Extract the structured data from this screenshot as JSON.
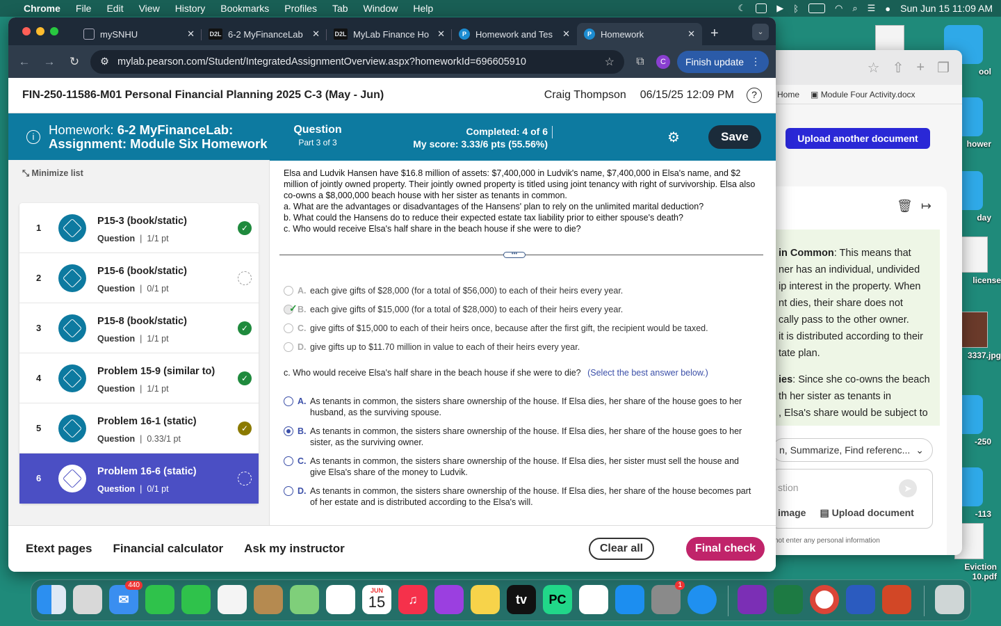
{
  "menubar": {
    "app": "Chrome",
    "items": [
      "File",
      "Edit",
      "View",
      "History",
      "Bookmarks",
      "Profiles",
      "Tab",
      "Window",
      "Help"
    ],
    "datetime": "Sun Jun 15  11:09 AM"
  },
  "desktop": {
    "icons": [
      "ool",
      "hower",
      "day",
      "license",
      "3337.jpg",
      "-250",
      "-113",
      "Eviction\n10.pdf"
    ]
  },
  "browser": {
    "tabs": [
      {
        "label": "mySNHU",
        "favicon": "shield-icon"
      },
      {
        "label": "6-2 MyFinanceLab",
        "favicon": "D2L"
      },
      {
        "label": "MyLab Finance Ho",
        "favicon": "D2L"
      },
      {
        "label": "Homework and Tes",
        "favicon": "P"
      },
      {
        "label": "Homework",
        "favicon": "P"
      }
    ],
    "url": "mylab.pearson.com/Student/IntegratedAssignmentOverview.aspx?homeworkId=696605910",
    "profile_initial": "C",
    "finish_update": "Finish update"
  },
  "course": {
    "title": "FIN-250-11586-M01 Personal Financial Planning 2025 C-3 (May - Jun)",
    "user": "Craig Thompson",
    "datetime": "06/15/25 12:09 PM",
    "help": "?"
  },
  "homework": {
    "line1_prefix": "Homework: ",
    "line1_bold": "6-2 MyFinanceLab:",
    "line2": "Assignment: Module Six Homework",
    "question_label": "Question",
    "part": "Part 3 of 3",
    "completed_label": "Completed: 4 of 6",
    "score_label": "My score: 3.33/6 pts (55.56%)",
    "save": "Save"
  },
  "sidebar": {
    "minimize": "Minimize list",
    "questions": [
      {
        "num": "1",
        "name": "P15-3 (book/static)",
        "type": "Question",
        "pts": "1/1 pt",
        "status": "done"
      },
      {
        "num": "2",
        "name": "P15-6 (book/static)",
        "type": "Question",
        "pts": "0/1 pt",
        "status": "empty"
      },
      {
        "num": "3",
        "name": "P15-8 (book/static)",
        "type": "Question",
        "pts": "1/1 pt",
        "status": "done"
      },
      {
        "num": "4",
        "name": "Problem 15-9 (similar to)",
        "type": "Question",
        "pts": "1/1 pt",
        "status": "done"
      },
      {
        "num": "5",
        "name": "Problem 16-1 (static)",
        "type": "Question",
        "pts": "0.33/1 pt",
        "status": "partial"
      },
      {
        "num": "6",
        "name": "Problem 16-6 (static)",
        "type": "Question",
        "pts": "0/1 pt",
        "status": "empty"
      }
    ]
  },
  "question": {
    "intro": "Elsa and Ludvik Hansen have $16.8 million of assets: $7,400,000 in Ludvik's name, $7,400,000 in Elsa's name, and $2 million of jointly owned property. Their jointly owned property is titled using joint tenancy with right of survivorship. Elsa also co-owns a $8,000,000 beach house with her sister as tenants in common.",
    "a": "a. What are the advantages or disadvantages of the Hansens' plan to rely on the unlimited marital deduction?",
    "b": "b. What could the Hansens do to reduce their expected estate tax liability prior to either spouse's death?",
    "c": "c. Who would receive Elsa's half share in the beach house if she were to die?",
    "divider_handle": "•••",
    "b_options": [
      {
        "letter": "A.",
        "text": "each give gifts of $28,000 (for a total of $56,000) to each of their heirs every year."
      },
      {
        "letter": "B.",
        "text": "each give gifts of $15,000 (for a total of $28,000) to each of their heirs every year."
      },
      {
        "letter": "C.",
        "text": "give gifts of $15,000 to each of their heirs once, because after the first gift, the recipient would be taxed."
      },
      {
        "letter": "D.",
        "text": "give gifts up to $11.70 million in value to each of their heirs every year."
      }
    ],
    "c_prompt": "c. Who would receive Elsa's half share in the beach house if she were to die?",
    "c_hint": "(Select the best answer below.)",
    "c_options": [
      {
        "letter": "A.",
        "text": "As tenants in common, the sisters share ownership of the house. If Elsa dies, her share of the house goes to her husband, as the surviving spouse."
      },
      {
        "letter": "B.",
        "text": "As tenants in common, the sisters share ownership of the house. If Elsa dies, her share of the house goes to her sister, as the surviving owner."
      },
      {
        "letter": "C.",
        "text": "As tenants in common, the sisters share ownership of the house. If Elsa dies, her sister must sell the house and give Elsa's share of the money to Ludvik."
      },
      {
        "letter": "D.",
        "text": "As tenants in common, the sisters share ownership of the house. If Elsa dies, her share of the house becomes part of  her estate and is distributed according to the Elsa's will."
      }
    ]
  },
  "footer": {
    "etext": "Etext pages",
    "calculator": "Financial calculator",
    "instructor": "Ask my instructor",
    "clear": "Clear all",
    "final": "Final check"
  },
  "side_window": {
    "tab_home": "Home",
    "tab_doc": "Module Four Activity.docx",
    "upload_btn": "Upload another document",
    "chat_lines": [
      {
        "bold": "in Common",
        "rest": ": This means that"
      },
      {
        "bold": "",
        "rest": "ner has an individual, undivided"
      },
      {
        "bold": "",
        "rest": "ip interest in the property. When"
      },
      {
        "bold": "",
        "rest": "nt dies, their share does not"
      },
      {
        "bold": "",
        "rest": "cally pass to the other owner."
      },
      {
        "bold": "",
        "rest": "it is distributed according to their"
      },
      {
        "bold": "",
        "rest": "tate plan."
      }
    ],
    "chat_lines2": [
      {
        "bold": "ies",
        "rest": ": Since she co-owns the beach"
      },
      {
        "bold": "",
        "rest": "th her sister as tenants in"
      },
      {
        "bold": "",
        "rest": ", Elsa's share would be subject to"
      }
    ],
    "select_text": "n, Summarize, Find referenc...",
    "input_placeholder": "stion",
    "image_btn": "image",
    "upload_doc": "Upload document",
    "disclaimer": "not enter any personal information"
  },
  "dock": {
    "mail_badge": "440",
    "settings_badge": "1",
    "calendar_month": "JUN",
    "calendar_day": "15",
    "tv": "tv",
    "pc": "PC"
  }
}
